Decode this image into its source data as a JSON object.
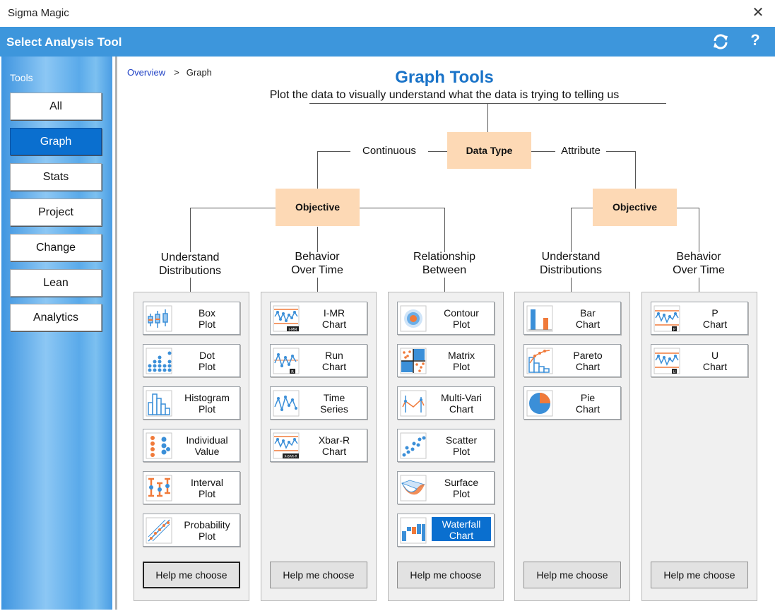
{
  "window": {
    "title": "Sigma Magic"
  },
  "header": {
    "title": "Select Analysis Tool",
    "help_label": "?"
  },
  "sidebar": {
    "label": "Tools",
    "items": [
      {
        "label": "All"
      },
      {
        "label": "Graph",
        "active": true
      },
      {
        "label": "Stats"
      },
      {
        "label": "Project"
      },
      {
        "label": "Change"
      },
      {
        "label": "Lean"
      },
      {
        "label": "Analytics"
      }
    ]
  },
  "breadcrumb": {
    "link": "Overview",
    "separator": ">",
    "current": "Graph"
  },
  "main": {
    "title": "Graph Tools",
    "subtitle": "Plot the data to visually understand what the data is trying to telling us",
    "data_type": "Data Type",
    "continuous": "Continuous",
    "attribute": "Attribute",
    "objective_left": "Objective",
    "objective_right": "Objective"
  },
  "categories": [
    {
      "line1": "Understand",
      "line2": "Distributions"
    },
    {
      "line1": "Behavior",
      "line2": "Over Time"
    },
    {
      "line1": "Relationship",
      "line2": "Between"
    },
    {
      "line1": "Understand",
      "line2": "Distributions"
    },
    {
      "line1": "Behavior",
      "line2": "Over Time"
    }
  ],
  "panels": [
    {
      "tools": [
        {
          "line1": "Box",
          "line2": "Plot",
          "icon": "box-plot-icon"
        },
        {
          "line1": "Dot",
          "line2": "Plot",
          "icon": "dot-plot-icon"
        },
        {
          "line1": "Histogram",
          "line2": "Plot",
          "icon": "histogram-icon"
        },
        {
          "line1": "Individual",
          "line2": "Value",
          "icon": "individual-value-icon"
        },
        {
          "line1": "Interval",
          "line2": "Plot",
          "icon": "interval-plot-icon"
        },
        {
          "line1": "Probability",
          "line2": "Plot",
          "icon": "probability-plot-icon"
        }
      ],
      "help": "Help me choose"
    },
    {
      "tools": [
        {
          "line1": "I-MR",
          "line2": "Chart",
          "icon": "imr-chart-icon",
          "tag": "I-MR"
        },
        {
          "line1": "Run",
          "line2": "Chart",
          "icon": "run-chart-icon",
          "tag": "R"
        },
        {
          "line1": "Time",
          "line2": "Series",
          "icon": "time-series-icon"
        },
        {
          "line1": "Xbar-R",
          "line2": "Chart",
          "icon": "xbar-r-chart-icon",
          "tag": "X-BAR-R"
        }
      ],
      "help": "Help me choose"
    },
    {
      "tools": [
        {
          "line1": "Contour",
          "line2": "Plot",
          "icon": "contour-plot-icon"
        },
        {
          "line1": "Matrix",
          "line2": "Plot",
          "icon": "matrix-plot-icon"
        },
        {
          "line1": "Multi-Vari",
          "line2": "Chart",
          "icon": "multi-vari-icon"
        },
        {
          "line1": "Scatter",
          "line2": "Plot",
          "icon": "scatter-plot-icon"
        },
        {
          "line1": "Surface",
          "line2": "Plot",
          "icon": "surface-plot-icon"
        },
        {
          "line1": "Waterfall",
          "line2": "Chart",
          "icon": "waterfall-chart-icon",
          "selected": true
        }
      ],
      "help": "Help me choose"
    },
    {
      "tools": [
        {
          "line1": "Bar",
          "line2": "Chart",
          "icon": "bar-chart-icon"
        },
        {
          "line1": "Pareto",
          "line2": "Chart",
          "icon": "pareto-chart-icon"
        },
        {
          "line1": "Pie",
          "line2": "Chart",
          "icon": "pie-chart-icon"
        }
      ],
      "help": "Help me choose"
    },
    {
      "tools": [
        {
          "line1": "P",
          "line2": "Chart",
          "icon": "p-chart-icon",
          "tag": "P"
        },
        {
          "line1": "U",
          "line2": "Chart",
          "icon": "u-chart-icon",
          "tag": "U"
        }
      ],
      "help": "Help me choose"
    }
  ],
  "colors": {
    "accent": "#3d96dc",
    "selected": "#0a6fcf",
    "objective": "#fdd9b5",
    "icon_blue": "#3b8fd8",
    "icon_orange": "#f07a3a"
  }
}
